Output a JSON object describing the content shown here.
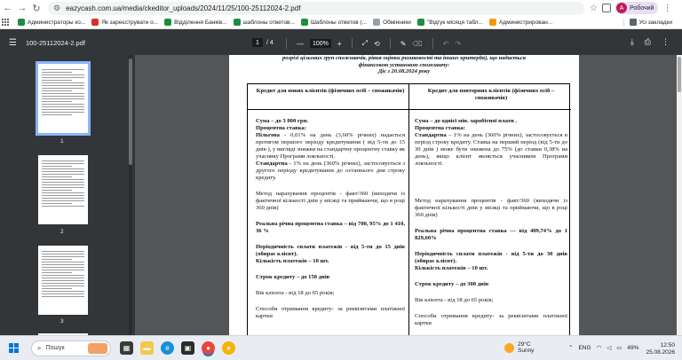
{
  "browser": {
    "url": "eazycash.com.ua/media/ckeditor_uploads/2024/11/25/100-25112024-2.pdf",
    "profile_initial": "A",
    "profile_name": "Робочий"
  },
  "bookmarks": {
    "items": [
      {
        "label": "Администраторы ко...",
        "color": "#1e8e3e"
      },
      {
        "label": "Як зареєструвати о...",
        "color": "#d93025"
      },
      {
        "label": "Відділення Банків...",
        "color": "#1e8e3e"
      },
      {
        "label": "шаблоны ответов...",
        "color": "#1e8e3e"
      },
      {
        "label": "Шаблоны ответов (...",
        "color": "#1e8e3e"
      },
      {
        "label": "Обмінники",
        "color": "#9aa0a6"
      },
      {
        "label": "\"Відгук місяця табл...",
        "color": "#1e8e3e"
      },
      {
        "label": "Администрирован...",
        "color": "#f29900"
      }
    ],
    "all_bookmarks": "Усі закладки"
  },
  "pdf_toolbar": {
    "filename": "100-25112024-2.pdf",
    "current_page": "1",
    "total_pages": "/ 4",
    "zoom": "100%"
  },
  "thumbnails": [
    "1",
    "2",
    "3"
  ],
  "document": {
    "header_line1": "розрізі цільових груп споживачів, рівня оцінки ризиковості та інших критеріїв), що надається",
    "header_line2": "фінансовою установою споживачу:",
    "header_line3": "Діє з 20.08.2024 року",
    "left": {
      "title": "Кредит для нових клієнтів (фізичних осіб – споживачів)",
      "sum": "Сума – до 3 000 грн.",
      "rate_label": "Процентна ставка:",
      "pref_label": "Пільгова",
      "pref_text": " - 0,01% на день (3,60% річних) надається протягом першого періоду кредитування ( від 5-ти до 15 днів ), у вигляді знижки на стандартну процентну ставку як учаснику Програми лояльності.",
      "std_label": "Стандартна",
      "std_text": " - 1% на день (360% річних), застосовується з другого періоду кредитування до останнього дня строку кредиту.",
      "method": "Метод нарахування процентів - факт/360 (виходячи із фактичної кількості днів у місяці та приймаючи, що в році 360 днів)",
      "real_rate": "Реальна річна процентна ставка – від 700, 95% до 1 410, 36 %",
      "periodicity": "Періодичність сплати платежів - від 5-ти до 15 днів (обирає клієнт).",
      "count": "Кількість платежів – 10 шт.",
      "term": "Строк кредиту – до 150 днів",
      "age": "Вік клієнта - від 18 до 65 років;",
      "method_get": "Способи отримання кредиту- за реквізитами платіжної картки"
    },
    "right": {
      "title": "Кредит для повторних клієнтів (фізичних осіб – споживачів)",
      "sum": "Сума – до однієї мін. заробітної плати .",
      "rate_label": "Процентна ставка:",
      "std_label": "Стандартна",
      "std_text": " – 1% на день (360% річних), застосовується в період строку кредиту. Ставка на перший період (від 5-ти до 30 днів ) може бути знижена до 75% (до ставки 0,38% на день), якщо клієнт являється учасником Програми лояльності.",
      "method": "Метод нарахування процентів - факт/360 (виходячи із фактичної кількості днів у місяці та приймаючи, що в році 360 днів)",
      "real_rate": "Реальна річна процентна ставка — від 409,74% до 1 829,60%",
      "periodicity": "Періодичність сплати платежів - від 5-ти до 30 днів (обирає клієнт).",
      "count": "Кількість платежів – 10 шт.",
      "term": "Строк кредиту – до 300 днів",
      "age": "Вік клієнта - від 18 до 65 років;",
      "method_get": "Способи отримання кредиту- за реквізитами платіжної картки"
    }
  },
  "taskbar": {
    "search_placeholder": "Пошук",
    "temp": "29°C",
    "weather": "Sunny",
    "lang": "ENG",
    "battery": "49%",
    "time": "12:50",
    "date": "25.08.2026"
  }
}
